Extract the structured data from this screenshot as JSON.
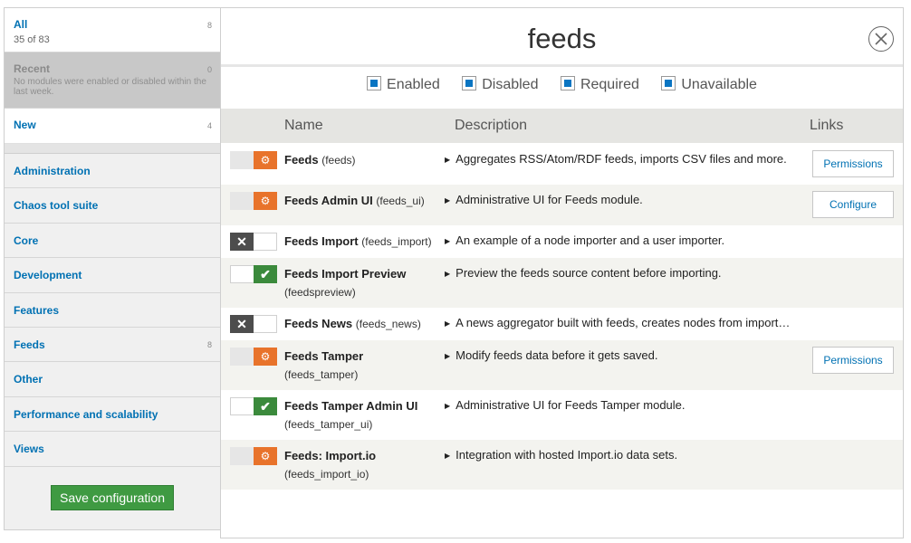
{
  "sidebar": {
    "all": {
      "label": "All",
      "count": "8",
      "sub": "35 of 83"
    },
    "recent": {
      "label": "Recent",
      "count": "0",
      "sub": "No modules were enabled or disabled within the last week."
    },
    "new": {
      "label": "New",
      "count": "4"
    },
    "categories": [
      {
        "label": "Administration",
        "count": ""
      },
      {
        "label": "Chaos tool suite",
        "count": ""
      },
      {
        "label": "Core",
        "count": ""
      },
      {
        "label": "Development",
        "count": ""
      },
      {
        "label": "Features",
        "count": ""
      },
      {
        "label": "Feeds",
        "count": "8"
      },
      {
        "label": "Other",
        "count": ""
      },
      {
        "label": "Performance and scalability",
        "count": ""
      },
      {
        "label": "Views",
        "count": ""
      }
    ],
    "save_label": "Save configuration"
  },
  "main": {
    "title": "feeds",
    "filters": [
      "Enabled",
      "Disabled",
      "Required",
      "Unavailable"
    ],
    "columns": {
      "name": "Name",
      "description": "Description",
      "links": "Links"
    },
    "modules": [
      {
        "name": "Feeds",
        "machine": "(feeds)",
        "description": "Aggregates RSS/Atom/RDF feeds, imports CSV files and more.",
        "state": "locked",
        "link": "Permissions"
      },
      {
        "name": "Feeds Admin UI",
        "machine": "(feeds_ui)",
        "description": "Administrative UI for Feeds module.",
        "state": "locked",
        "link": "Configure"
      },
      {
        "name": "Feeds Import",
        "machine": "(feeds_import)",
        "description": "An example of a node importer and a user importer.",
        "state": "off",
        "link": ""
      },
      {
        "name": "Feeds Import Preview",
        "machine": "(feedspreview)",
        "description": "Preview the feeds source content before importing.",
        "state": "on",
        "link": ""
      },
      {
        "name": "Feeds News",
        "machine": "(feeds_news)",
        "description": "A news aggregator built with feeds, creates nodes from import…",
        "state": "off",
        "link": ""
      },
      {
        "name": "Feeds Tamper",
        "machine": "(feeds_tamper)",
        "description": "Modify feeds data before it gets saved.",
        "state": "locked",
        "link": "Permissions"
      },
      {
        "name": "Feeds Tamper Admin UI",
        "machine": "(feeds_tamper_ui)",
        "description": "Administrative UI for Feeds Tamper module.",
        "state": "on",
        "link": ""
      },
      {
        "name": "Feeds: Import.io",
        "machine": "(feeds_import_io)",
        "description": "Integration with hosted Import.io data sets.",
        "state": "locked",
        "link": ""
      }
    ]
  },
  "colors": {
    "link": "#0071b3",
    "locked": "#e8732b",
    "enabled": "#3b8a3c",
    "disabled": "#4d4d4d",
    "save": "#3f9a42"
  }
}
